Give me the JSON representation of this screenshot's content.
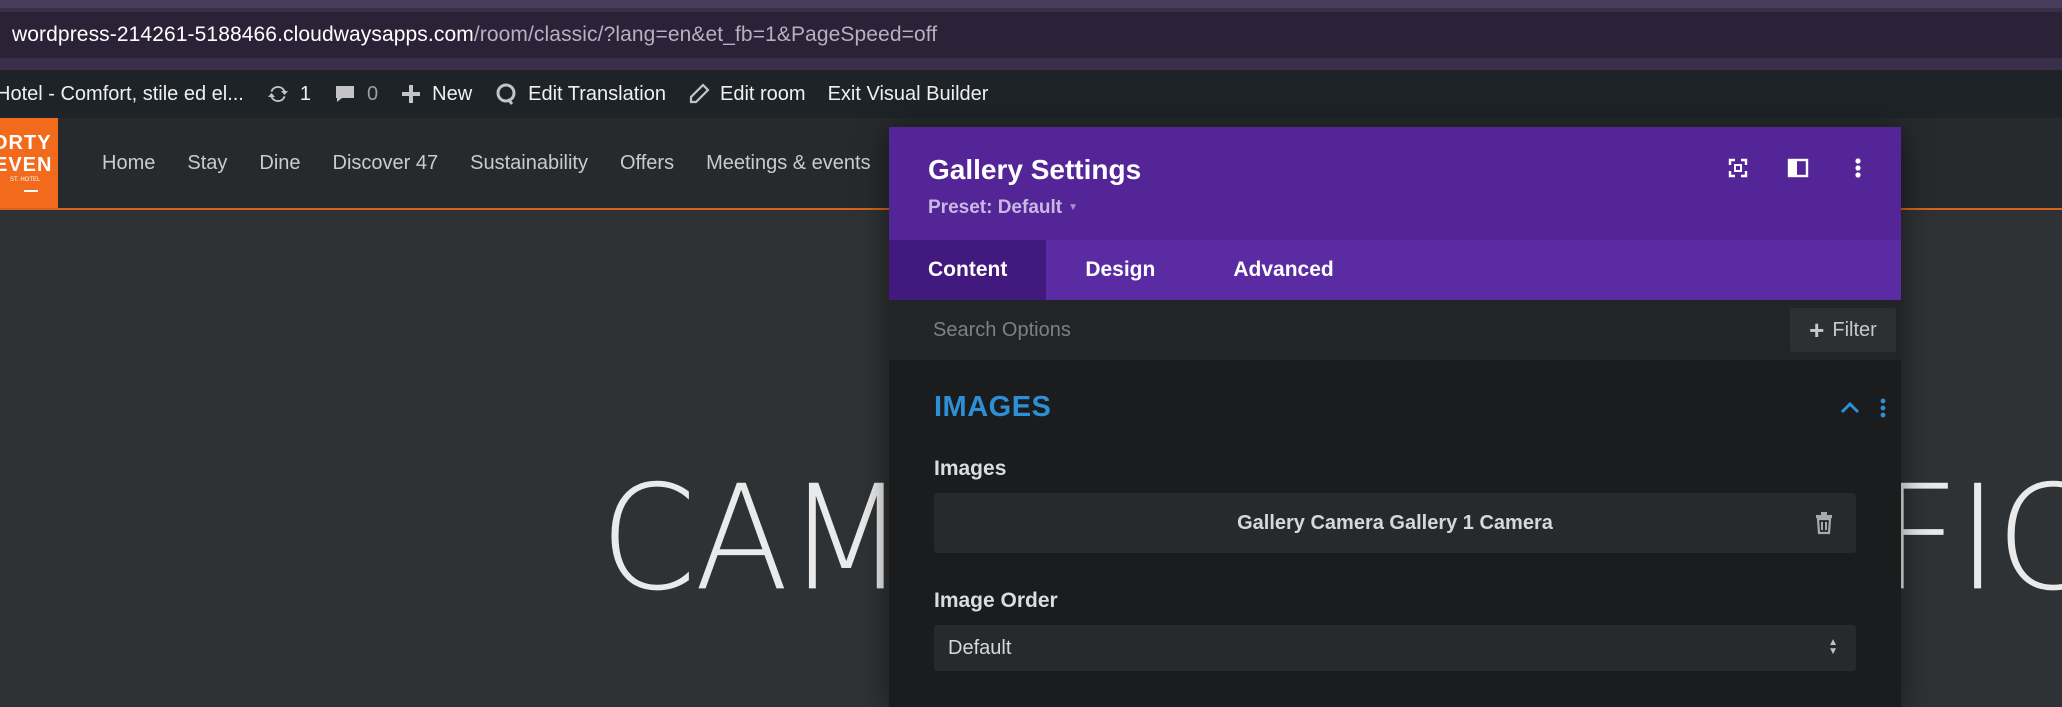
{
  "browser": {
    "url_host": "wordpress-214261-5188466.cloudwaysapps.com",
    "url_path": "/room/classic/?lang=en&et_fb=1&PageSpeed=off"
  },
  "adminbar": {
    "site_name": "Hotel - Comfort, stile ed el...",
    "updates_count": "1",
    "comments_count": "0",
    "new_label": "New",
    "translation_label": "Edit Translation",
    "edit_label": "Edit room",
    "exit_label": "Exit Visual Builder"
  },
  "site": {
    "logo_line1": "ORTY",
    "logo_line2": "EVEN",
    "logo_line3": "ST. HOTEL",
    "nav": [
      "Home",
      "Stay",
      "Dine",
      "Discover 47",
      "Sustainability",
      "Offers",
      "Meetings & events"
    ],
    "hero_left": "CAM",
    "hero_right": "FIC"
  },
  "modal": {
    "title": "Gallery Settings",
    "preset": "Preset: Default",
    "tabs": [
      "Content",
      "Design",
      "Advanced"
    ],
    "search_placeholder": "Search Options",
    "filter_label": "Filter",
    "section_title": "IMAGES",
    "images_label": "Images",
    "gallery_value": "Gallery Camera Gallery 1 Camera",
    "order_label": "Image Order",
    "order_value": "Default"
  },
  "colors": {
    "accent_purple": "#532597",
    "section_blue": "#2d8fd6",
    "brand_orange": "#f26a1b"
  }
}
